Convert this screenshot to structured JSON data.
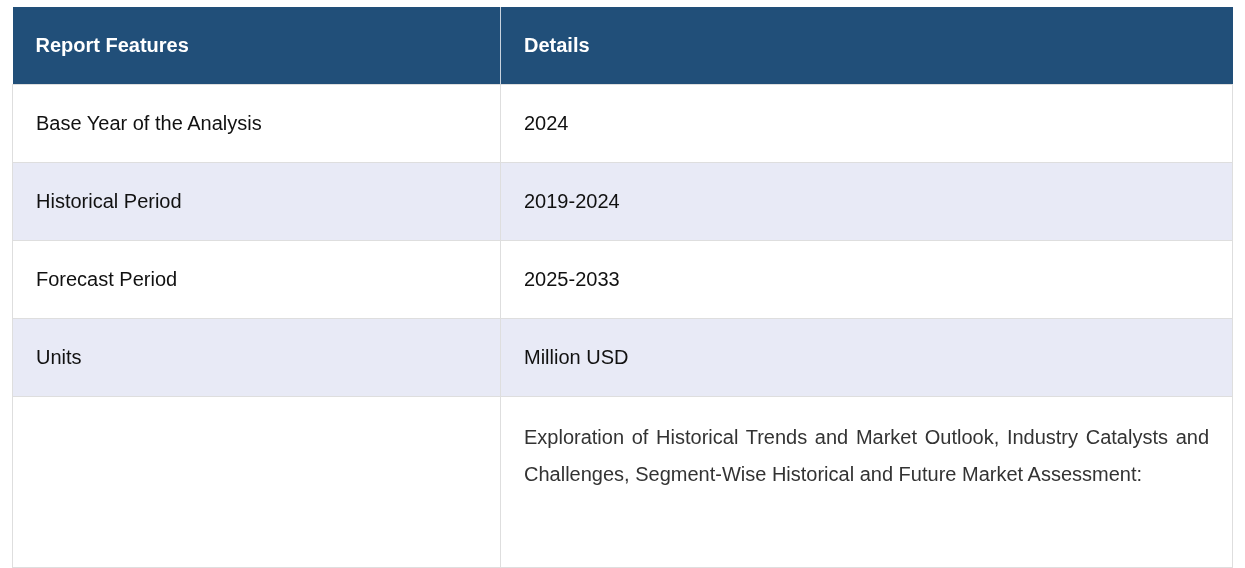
{
  "table": {
    "columns": [
      "Report Features",
      "Details"
    ],
    "rows": [
      {
        "feature": "Base Year of the Analysis",
        "detail": "2024"
      },
      {
        "feature": "Historical Period",
        "detail": "2019-2024"
      },
      {
        "feature": "Forecast Period",
        "detail": "2025-2033"
      },
      {
        "feature": "Units",
        "detail": "Million USD"
      },
      {
        "feature": "",
        "detail": "Exploration of Historical Trends and Market Outlook, Industry Catalysts and Challenges, Segment-Wise Historical and Future Market Assessment:",
        "kind": "paragraph"
      }
    ]
  }
}
